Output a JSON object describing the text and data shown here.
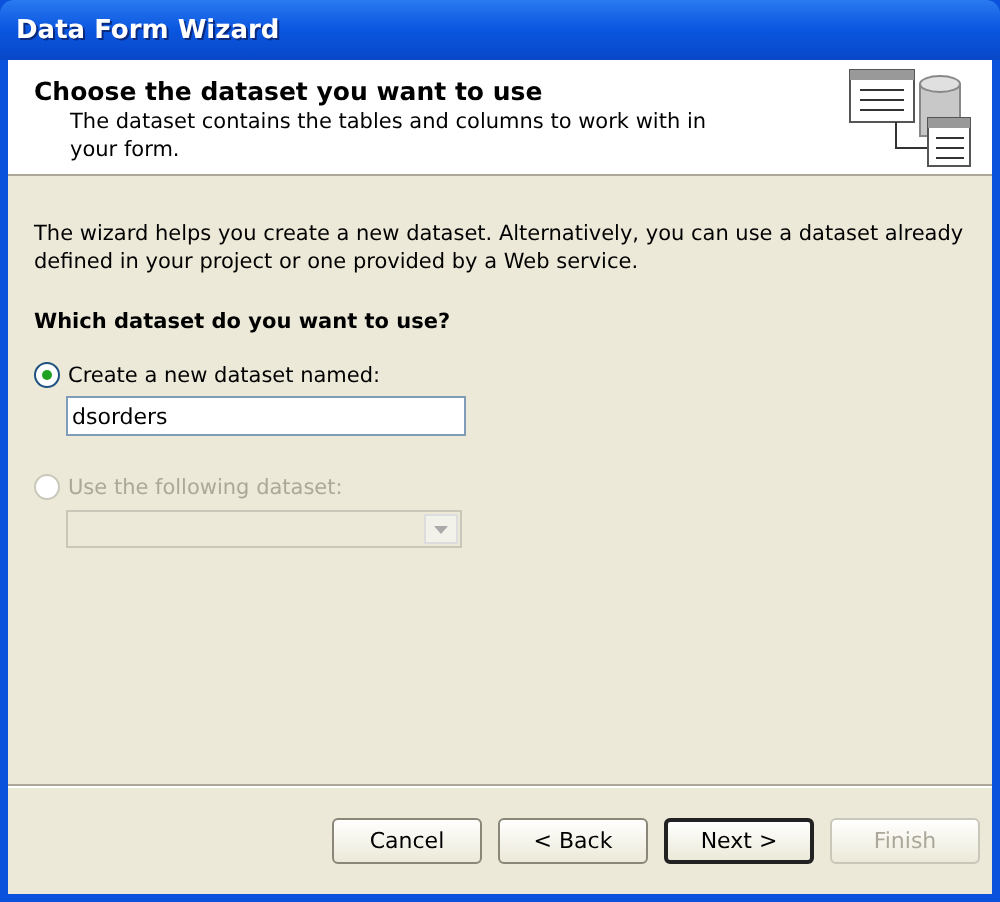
{
  "window": {
    "title": "Data Form Wizard"
  },
  "header": {
    "title": "Choose the dataset you want to use",
    "subtitle": "The dataset contains the tables and columns to work with in your form."
  },
  "intro": "The wizard helps you create a new dataset. Alternatively, you can use a dataset already defined in your project or one provided by a Web service.",
  "question": "Which dataset do you want to use?",
  "options": [
    {
      "kind": "textbox",
      "label": "Create a new dataset named:",
      "selected": true,
      "disabled": false,
      "value": "dsorders"
    },
    {
      "kind": "dropdown",
      "label": "Use the following dataset:",
      "selected": false,
      "disabled": true
    }
  ],
  "buttons": [
    {
      "label": "Cancel",
      "disabled": false,
      "default": false
    },
    {
      "label": "< Back",
      "disabled": false,
      "default": false
    },
    {
      "label": "Next >",
      "disabled": false,
      "default": true
    },
    {
      "label": "Finish",
      "disabled": true,
      "default": false
    }
  ]
}
